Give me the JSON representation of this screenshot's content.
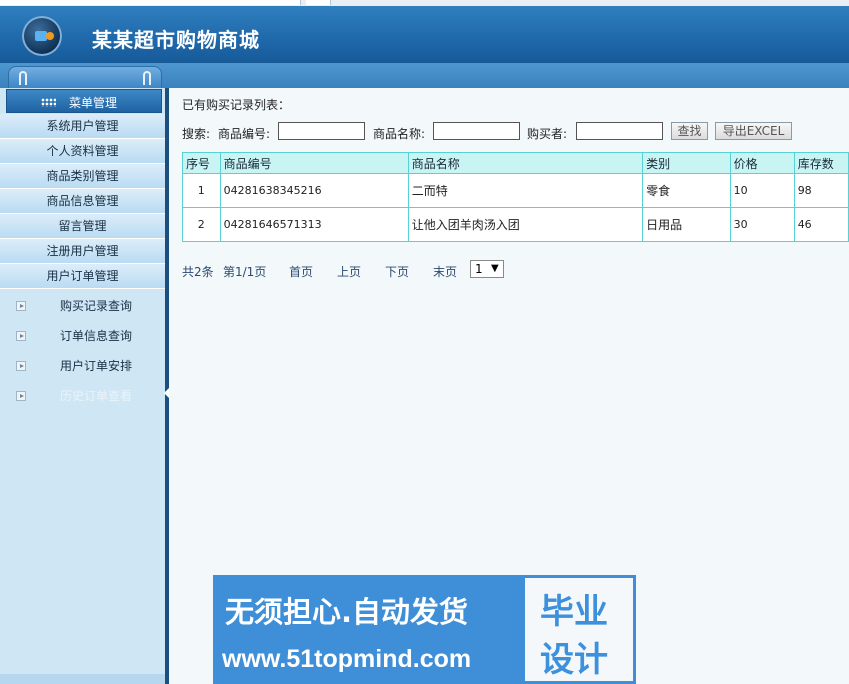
{
  "site": {
    "title": "某某超市购物商城"
  },
  "sidebar": {
    "heading": "菜单管理",
    "items": [
      "系统用户管理",
      "个人资料管理",
      "商品类别管理",
      "商品信息管理",
      "留言管理",
      "注册用户管理",
      "用户订单管理"
    ],
    "subitems": [
      "购买记录查询",
      "订单信息查询",
      "用户订单安排",
      "历史订单查看"
    ],
    "active_subitem": "历史订单查看"
  },
  "content": {
    "list_title": "已有购买记录列表：",
    "search": {
      "label": "搜索:",
      "code_label": "商品编号:",
      "name_label": "商品名称:",
      "buyer_label": "购买者:",
      "search_button": "查找",
      "export_button": "导出EXCEL"
    },
    "table": {
      "headers": [
        "序号",
        "商品编号",
        "商品名称",
        "类别",
        "价格",
        "库存数"
      ],
      "rows": [
        [
          "1",
          "04281638345216",
          "二而特",
          "零食",
          "10",
          "98"
        ],
        [
          "2",
          "04281646571313",
          "让他入团羊肉汤入团",
          "日用品",
          "30",
          "46"
        ]
      ]
    },
    "pager": {
      "total": "共2条",
      "page": "第1/1页",
      "first": "首页",
      "prev": "上页",
      "next": "下页",
      "last": "末页",
      "selected": "1"
    }
  },
  "ad": {
    "line1": "无须担心.自动发货",
    "line2": "www.51topmind.com",
    "badge1": "毕业",
    "badge2": "设计"
  }
}
